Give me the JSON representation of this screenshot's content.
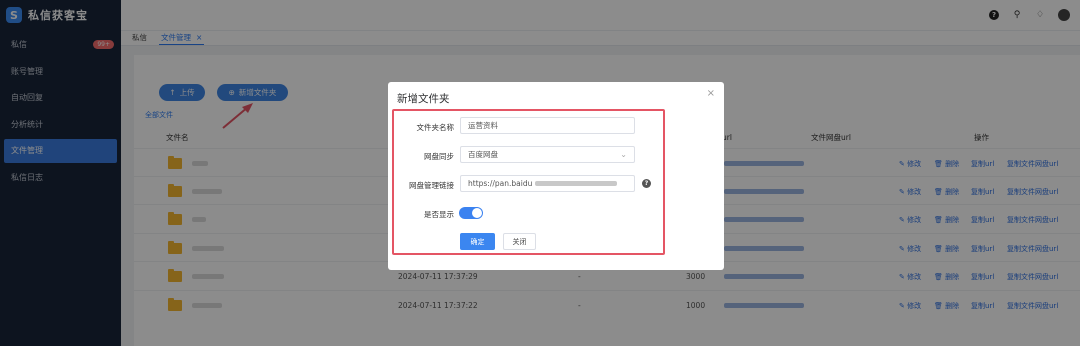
{
  "app": {
    "name": "私信获客宝"
  },
  "sidebar": {
    "items": [
      {
        "label": "私信",
        "badge": "99+"
      },
      {
        "label": "账号管理"
      },
      {
        "label": "自动回复"
      },
      {
        "label": "分析统计"
      },
      {
        "label": "文件管理",
        "active": true
      },
      {
        "label": "私信日志"
      }
    ]
  },
  "topbar": {
    "icons": [
      "help-icon",
      "search-icon",
      "bell-icon",
      "avatar"
    ]
  },
  "tabs": [
    {
      "label": "私信"
    },
    {
      "label": "文件管理",
      "active": true,
      "close": "×"
    }
  ],
  "toolbar": {
    "upload_label": "上传",
    "new_folder_label": "新增文件夹",
    "all_files_label": "全部文件"
  },
  "table": {
    "columns": [
      "文件名",
      "链接url",
      "文件网盘url",
      "操作"
    ],
    "actions": [
      "修改",
      "删除",
      "复制url",
      "复制文件网盘url"
    ],
    "rows": [
      {
        "time": "",
        "dash": "",
        "size": ""
      },
      {
        "time": "",
        "dash": "",
        "size": ""
      },
      {
        "time": "",
        "dash": "",
        "size": ""
      },
      {
        "time": "",
        "dash": "",
        "size": ""
      },
      {
        "time": "2024-07-11 17:37:29",
        "dash": "-",
        "size": "3000"
      },
      {
        "time": "2024-07-11 17:37:22",
        "dash": "-",
        "size": "1000"
      }
    ]
  },
  "modal": {
    "title": "新增文件夹",
    "close": "×",
    "fields": {
      "folder_name_label": "文件夹名称",
      "folder_name_value": "运营资料",
      "sync_label": "网盘同步",
      "sync_value": "百度网盘",
      "link_label": "网盘管理链接",
      "link_value": "https://pan.baidu",
      "show_label": "是否显示",
      "show_value": true
    },
    "confirm_label": "确定",
    "cancel_label": "关闭"
  },
  "colors": {
    "accent": "#3b82f0",
    "sidebar": "#18253a",
    "highlight": "#e45564"
  }
}
